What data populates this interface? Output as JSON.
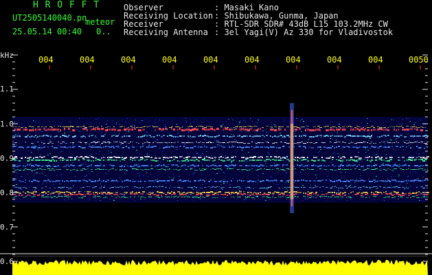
{
  "header": {
    "program": "H R O F F T",
    "filename": "UT2505140040.pn",
    "mode": "meteor",
    "datetime": "25.05.14 00:40",
    "counter": "0..",
    "observer_label": "Observer",
    "observer_value": ": Masaki Kano",
    "location_label": "Receiving Location",
    "location_value": ": Shibukawa, Gunma, Japan",
    "receiver_label": "Receiver",
    "receiver_value": ": RTL-SDR SDR# 43dB L15 103.2MHz CW",
    "antenna_label": "Receiving Antenna",
    "antenna_value": ": 3el Yagi(V) Az 330 for Vladivostok"
  },
  "axis": {
    "unit": "kHz",
    "y_ticks": [
      "1.1",
      "1.0",
      "0.9",
      "0.8",
      "0.7",
      "0.6"
    ],
    "time_ticks": [
      "004",
      "004",
      "004",
      "004",
      "004",
      "004",
      "004",
      "004",
      "004",
      "0050"
    ]
  },
  "colors": {
    "text_green": "#33ff33",
    "tick_yellow": "#ffff00",
    "background": "#000000"
  }
}
